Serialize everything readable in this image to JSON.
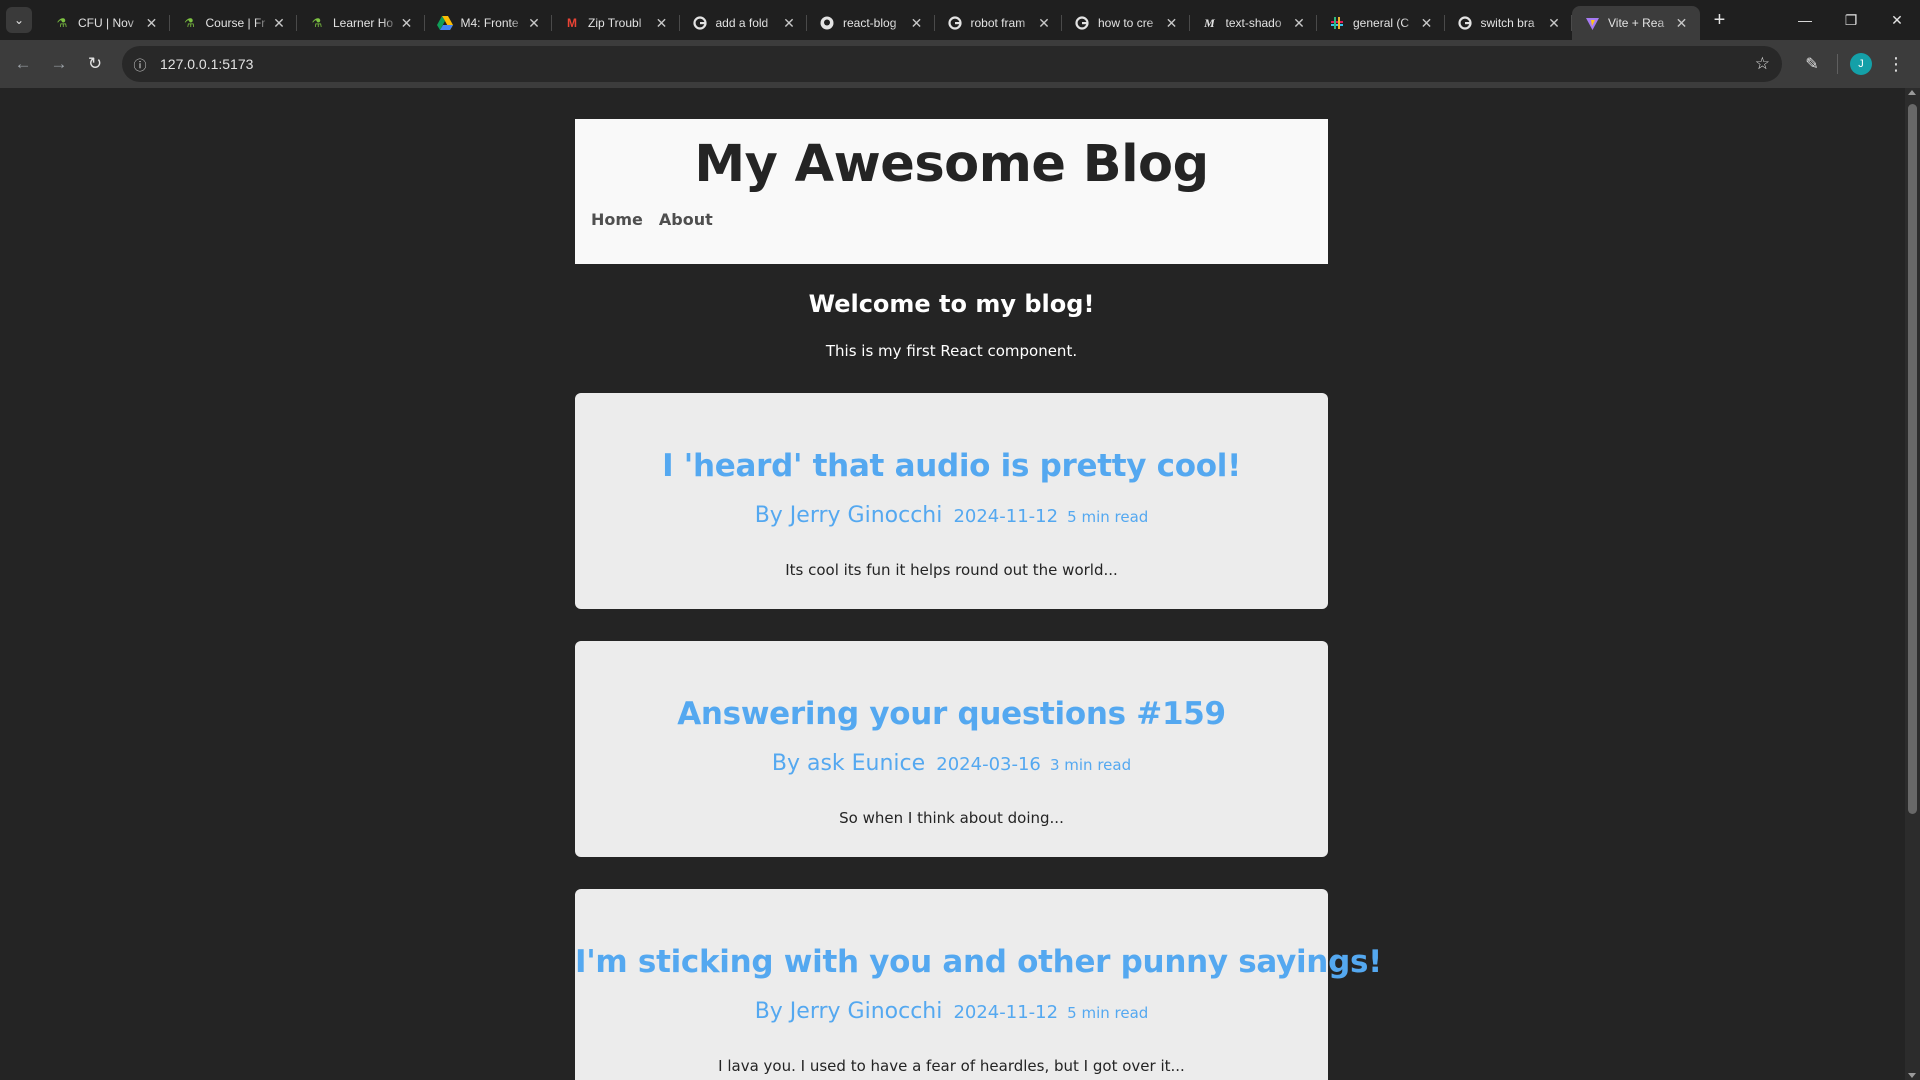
{
  "browser": {
    "tabs": [
      {
        "title": "CFU | Nov",
        "icon": "leaf-icon",
        "active": false
      },
      {
        "title": "Course | Fr",
        "icon": "leaf-icon",
        "active": false
      },
      {
        "title": "Learner Ho",
        "icon": "leaf-icon",
        "active": false
      },
      {
        "title": "M4: Fronte",
        "icon": "google-drive-icon",
        "active": false
      },
      {
        "title": "Zip Troubl",
        "icon": "gmail-icon",
        "active": false
      },
      {
        "title": "add a fold",
        "icon": "google-icon",
        "active": false
      },
      {
        "title": "react-blog",
        "icon": "github-icon",
        "active": false
      },
      {
        "title": "robot fram",
        "icon": "google-icon",
        "active": false
      },
      {
        "title": "how to cre",
        "icon": "google-icon",
        "active": false
      },
      {
        "title": "text-shado",
        "icon": "medium-icon",
        "active": false
      },
      {
        "title": "general (C",
        "icon": "slack-icon",
        "active": false
      },
      {
        "title": "switch bra",
        "icon": "google-icon",
        "active": false
      },
      {
        "title": "Vite + Rea",
        "icon": "vite-icon",
        "active": true
      }
    ],
    "url": "127.0.0.1:5173",
    "profile_initial": "J"
  },
  "blog": {
    "title": "My Awesome Blog",
    "nav": [
      {
        "label": "Home"
      },
      {
        "label": "About"
      }
    ],
    "welcome_heading": "Welcome to my blog!",
    "welcome_text": "This is my first React component.",
    "posts": [
      {
        "title": "I 'heard' that audio is pretty cool!",
        "author": "By Jerry Ginocchi",
        "date": "2024-11-12",
        "read_time": "5 min read",
        "excerpt": "Its cool its fun it helps round out the world..."
      },
      {
        "title": "Answering your questions #159",
        "author": "By ask Eunice",
        "date": "2024-03-16",
        "read_time": "3 min read",
        "excerpt": "So when I think about doing..."
      },
      {
        "title": "I'm sticking with you and other punny sayings!",
        "author": "By Jerry Ginocchi",
        "date": "2024-11-12",
        "read_time": "5 min read",
        "excerpt": "I lava you. I used to have a fear of heardles, but I got over it..."
      }
    ]
  },
  "colors": {
    "page_bg": "#242424",
    "header_bg": "#f9f9f9",
    "card_bg": "#ececec",
    "accent": "#54a8f0"
  }
}
